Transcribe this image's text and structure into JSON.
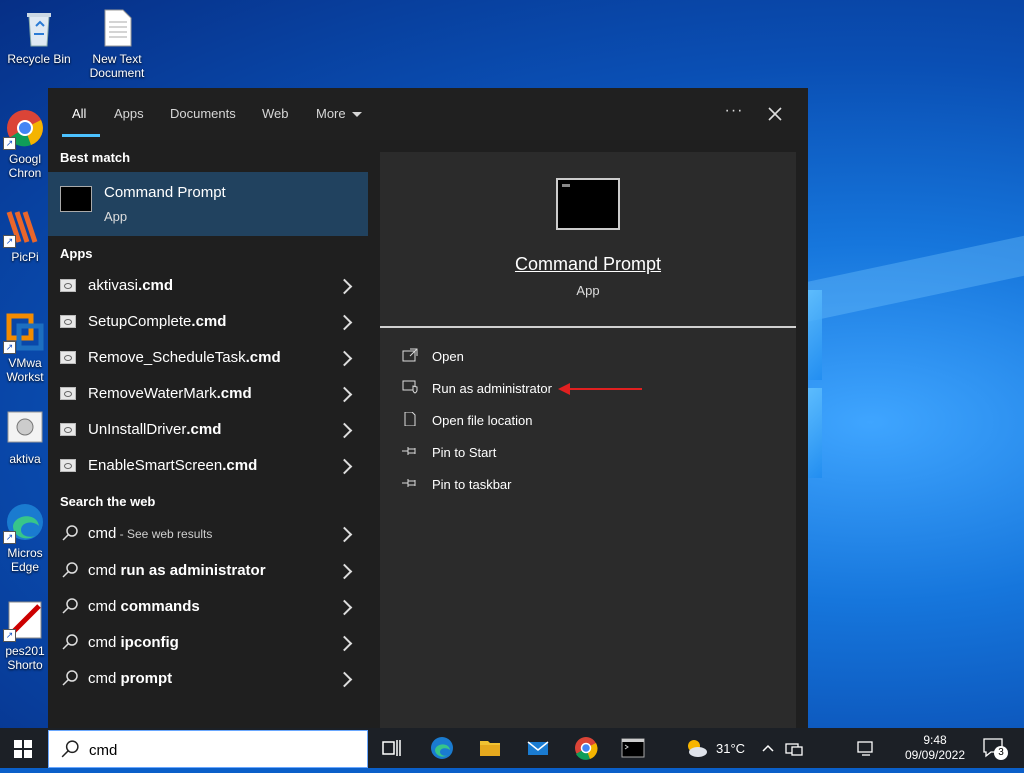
{
  "desktop": {
    "icons": [
      {
        "label": "Recycle Bin"
      },
      {
        "label": "New Text Document"
      },
      {
        "label": "Googl Chron"
      },
      {
        "label": "PicPi"
      },
      {
        "label": "VMwa Workst"
      },
      {
        "label": "aktiva"
      },
      {
        "label": "Micros Edge"
      },
      {
        "label": "pes201 Shorto"
      }
    ]
  },
  "search_panel": {
    "tabs": [
      {
        "label": "All"
      },
      {
        "label": "Apps"
      },
      {
        "label": "Documents"
      },
      {
        "label": "Web"
      },
      {
        "label": "More"
      }
    ],
    "more_icon": "ellipsis-icon",
    "close_icon": "close-icon",
    "best_match": {
      "heading": "Best match",
      "title": "Command Prompt",
      "subtitle": "App"
    },
    "apps": {
      "heading": "Apps",
      "items": [
        {
          "name": "aktivasi",
          "ext": ".cmd"
        },
        {
          "name": "SetupComplete",
          "ext": ".cmd"
        },
        {
          "name": "Remove_ScheduleTask",
          "ext": ".cmd"
        },
        {
          "name": "RemoveWaterMark",
          "ext": ".cmd"
        },
        {
          "name": "UnInstallDriver",
          "ext": ".cmd"
        },
        {
          "name": "EnableSmartScreen",
          "ext": ".cmd"
        }
      ]
    },
    "web": {
      "heading": "Search the web",
      "items": [
        {
          "query": "cmd",
          "bold": "",
          "suffix": " - See web results"
        },
        {
          "query": "cmd ",
          "bold": "run as administrator",
          "suffix": ""
        },
        {
          "query": "cmd ",
          "bold": "commands",
          "suffix": ""
        },
        {
          "query": "cmd ",
          "bold": "ipconfig",
          "suffix": ""
        },
        {
          "query": "cmd ",
          "bold": "prompt",
          "suffix": ""
        }
      ]
    },
    "preview": {
      "title": "Command Prompt",
      "subtitle": "App",
      "actions": [
        {
          "label": "Open",
          "icon": "open-icon"
        },
        {
          "label": "Run as administrator",
          "icon": "shield-icon"
        },
        {
          "label": "Open file location",
          "icon": "file-icon"
        },
        {
          "label": "Pin to Start",
          "icon": "pin-icon"
        },
        {
          "label": "Pin to taskbar",
          "icon": "pin-icon"
        }
      ]
    }
  },
  "taskbar": {
    "search_value": "cmd",
    "weather": "31°C",
    "time": "9:48",
    "date": "09/09/2022",
    "notification_count": "3"
  },
  "colors": {
    "accent": "#4cc2ff",
    "selected_row": "#21425f",
    "annotation_arrow": "#e02020"
  }
}
